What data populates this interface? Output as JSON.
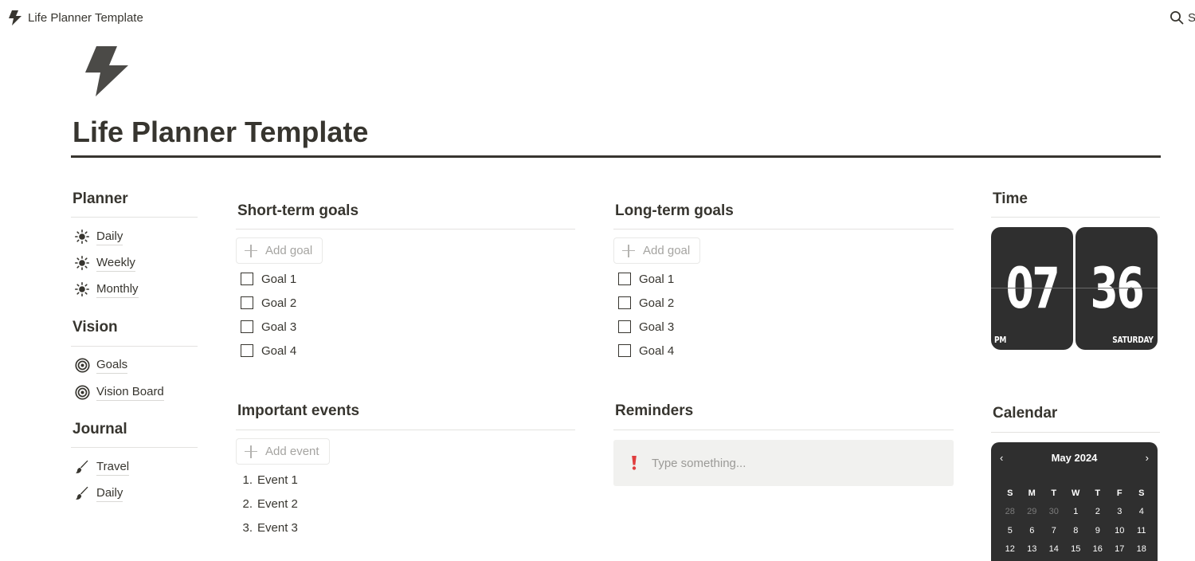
{
  "topbar": {
    "breadcrumb": "Life Planner Template",
    "search_label": "S"
  },
  "page": {
    "title": "Life Planner Template"
  },
  "sidebar": {
    "sections": [
      {
        "heading": "Planner",
        "items": [
          {
            "label": "Daily",
            "icon": "sun-icon"
          },
          {
            "label": "Weekly",
            "icon": "sun-icon"
          },
          {
            "label": "Monthly",
            "icon": "sun-icon"
          }
        ]
      },
      {
        "heading": "Vision",
        "items": [
          {
            "label": "Goals",
            "icon": "target-icon"
          },
          {
            "label": "Vision Board",
            "icon": "target-icon"
          }
        ]
      },
      {
        "heading": "Journal",
        "items": [
          {
            "label": "Travel",
            "icon": "paintbrush-icon"
          },
          {
            "label": "Daily",
            "icon": "paintbrush-icon"
          }
        ]
      }
    ]
  },
  "short_term": {
    "heading": "Short-term goals",
    "add_label": "Add goal",
    "goals": [
      "Goal 1",
      "Goal 2",
      "Goal 3",
      "Goal 4"
    ]
  },
  "long_term": {
    "heading": "Long-term goals",
    "add_label": "Add goal",
    "goals": [
      "Goal 1",
      "Goal 2",
      "Goal 3",
      "Goal 4"
    ]
  },
  "events": {
    "heading": "Important events",
    "add_label": "Add event",
    "items": [
      {
        "num": "1.",
        "label": "Event 1"
      },
      {
        "num": "2.",
        "label": "Event 2"
      },
      {
        "num": "3.",
        "label": "Event 3"
      }
    ]
  },
  "reminders": {
    "heading": "Reminders",
    "placeholder": "Type something..."
  },
  "time": {
    "heading": "Time",
    "hour": "07",
    "minute": "36",
    "meridiem": "PM",
    "weekday": "SATURDAY"
  },
  "calendar": {
    "heading": "Calendar",
    "month": "May 2024",
    "prev": "‹",
    "next": "›",
    "weekdays": [
      "S",
      "M",
      "T",
      "W",
      "T",
      "F",
      "S"
    ],
    "weeks": [
      [
        "28",
        "29",
        "30",
        "1",
        "2",
        "3",
        "4"
      ],
      [
        "5",
        "6",
        "7",
        "8",
        "9",
        "10",
        "11"
      ],
      [
        "12",
        "13",
        "14",
        "15",
        "16",
        "17",
        "18"
      ]
    ],
    "muted_days": [
      "28",
      "29",
      "30"
    ]
  },
  "colors": {
    "text": "#37352f",
    "widget_bg": "#2f2f2f",
    "reminder_bg": "#f1f1ef",
    "reminder_icon": "#e03e3e"
  }
}
